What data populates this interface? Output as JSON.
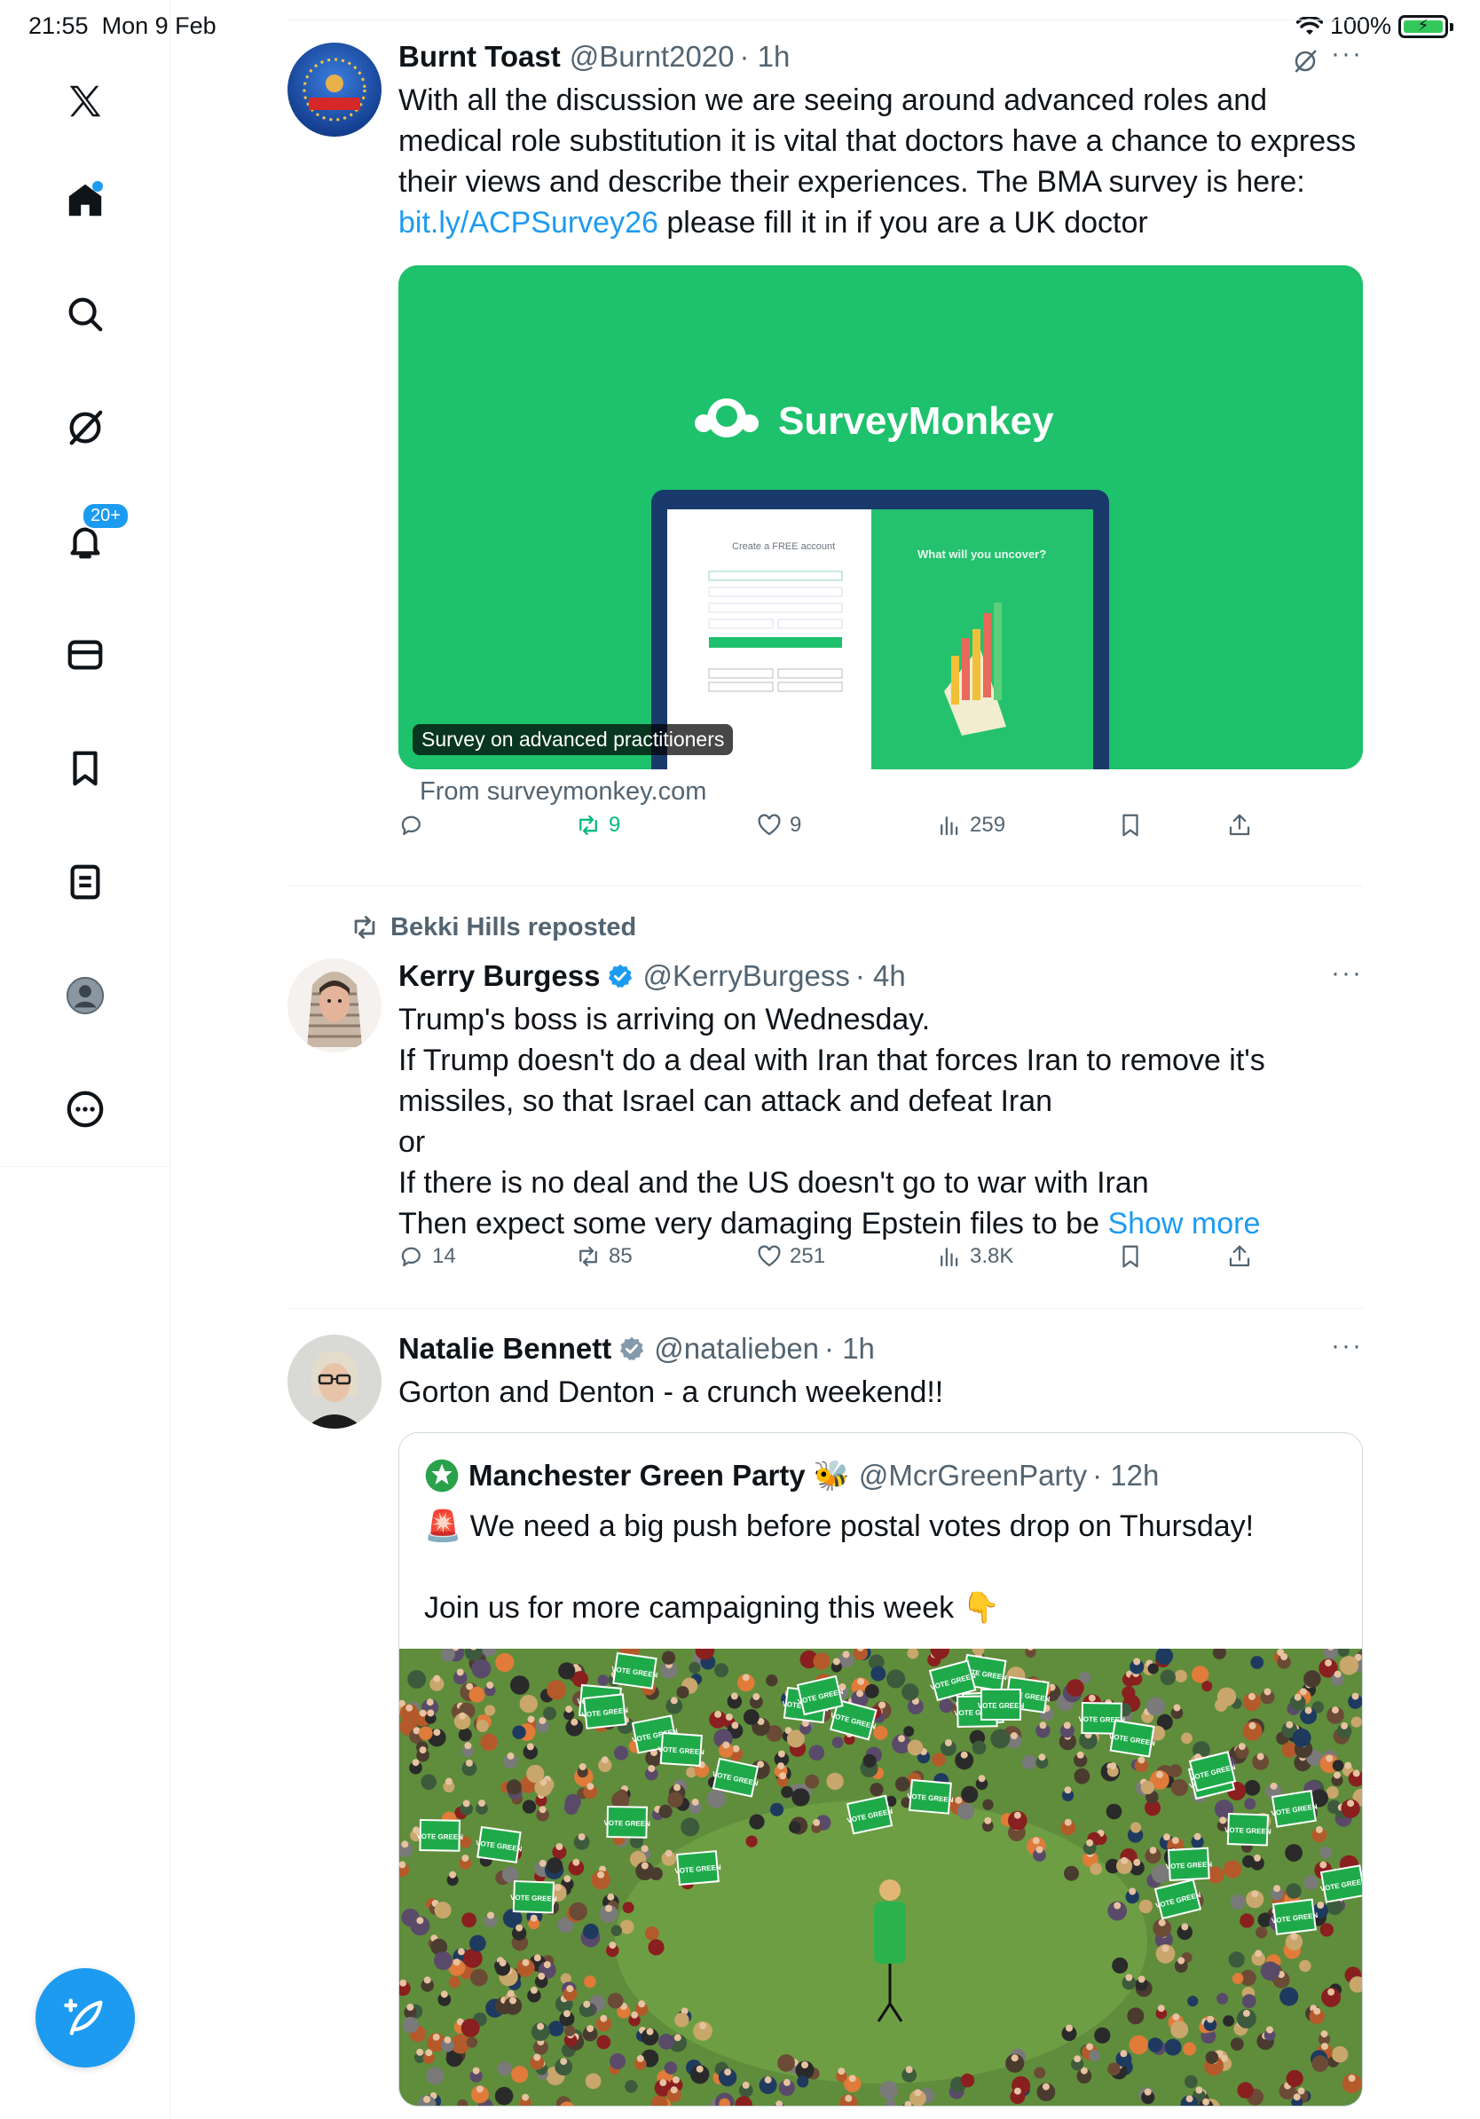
{
  "status_bar": {
    "time": "21:55",
    "date": "Mon 9 Feb",
    "battery": "100%"
  },
  "sidebar": {
    "items": [
      {
        "name": "x-logo-icon"
      },
      {
        "name": "home-icon"
      },
      {
        "name": "search-icon"
      },
      {
        "name": "grok-icon"
      },
      {
        "name": "notifications-icon",
        "badge": "20+"
      },
      {
        "name": "messages-icon"
      },
      {
        "name": "bookmarks-icon"
      },
      {
        "name": "lists-icon"
      },
      {
        "name": "profile-icon"
      },
      {
        "name": "more-icon"
      }
    ]
  },
  "posts": [
    {
      "name": "Burnt Toast",
      "handle": "@Burnt2020",
      "time": "· 1h",
      "text_before_link": "With all the discussion we are seeing around advanced roles and medical role substitution it is vital that doctors have a chance to express their views and describe their experiences. The BMA survey is here: ",
      "link": "bit.ly/ACPSurvey26",
      "text_after_link": " please fill it in if you are a UK doctor",
      "card": {
        "brand": "SurveyMonkey",
        "label": "Survey on advanced practitioners",
        "from": "From surveymonkey.com",
        "screen_title": "Create a FREE account",
        "screen_right": "What will you uncover?"
      },
      "actions": {
        "replies": "",
        "reposts": "9",
        "likes": "9",
        "views": "259"
      }
    },
    {
      "repost_by": "Bekki Hills reposted",
      "name": "Kerry Burgess",
      "handle": "@KerryBurgess",
      "time": "· 4h",
      "lines": [
        "Trump's boss is arriving on Wednesday.",
        "If Trump doesn't do a deal with Iran that forces Iran to remove it's missiles, so that Israel can attack and defeat Iran",
        "or",
        "If there is no deal and the US doesn't go to war with Iran"
      ],
      "last_line": "Then expect some very damaging Epstein files to be ",
      "show_more": "Show more",
      "actions": {
        "replies": "14",
        "reposts": "85",
        "likes": "251",
        "views": "3.8K"
      }
    },
    {
      "name": "Natalie Bennett",
      "handle": "@natalieben",
      "time": "· 1h",
      "text": "Gorton and Denton - a crunch weekend!!",
      "quote": {
        "name": "Manchester Green Party 🐝",
        "handle": "@McrGreenParty",
        "time": "· 12h",
        "line1": "🚨 We need a big push before postal votes drop on Thursday!",
        "line2": "Join us for more campaigning this week 👇",
        "sign_text": "VOTE GREEN"
      }
    }
  ],
  "colors": {
    "accent": "#1d9bf0",
    "repost_green": "#00ba7c",
    "secondary_text": "#536471",
    "surveymonkey_green": "#1ec16c"
  }
}
